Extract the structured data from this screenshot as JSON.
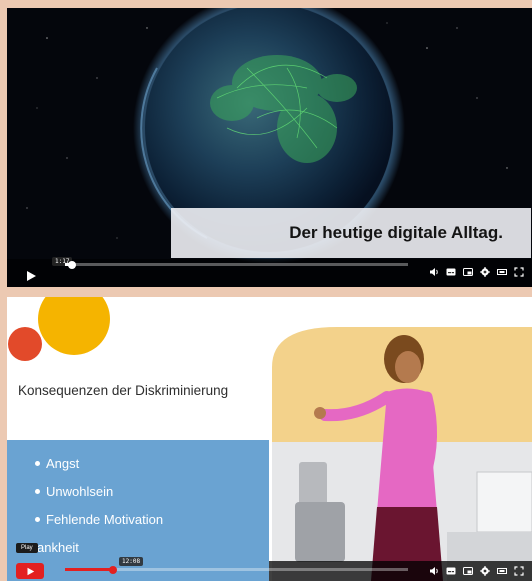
{
  "video_1": {
    "caption": "Der heutige digitale Alltag.",
    "timestamp": "1:17",
    "progress": 0.02,
    "controls": {
      "play_icon": "play-icon",
      "volume_icon": "volume-icon",
      "subtitles_icon": "subtitles-icon",
      "miniplayer_icon": "miniplayer-icon",
      "settings_icon": "gear-icon",
      "theater_icon": "theater-icon",
      "fullscreen_icon": "fullscreen-icon"
    }
  },
  "video_2": {
    "heading": "Konsequenzen der Diskriminierung",
    "bullets": [
      "Angst",
      "Unwohlsein",
      "Fehlende Motivation",
      "Krankheit"
    ],
    "tooltip": "Play",
    "timestamp": "12:08",
    "progress": 0.14,
    "accent_color": "#e32020",
    "controls": {
      "play_icon": "play-icon",
      "volume_icon": "volume-icon",
      "subtitles_icon": "subtitles-icon",
      "miniplayer_icon": "miniplayer-icon",
      "settings_icon": "gear-icon",
      "theater_icon": "theater-icon",
      "fullscreen_icon": "fullscreen-icon"
    }
  }
}
